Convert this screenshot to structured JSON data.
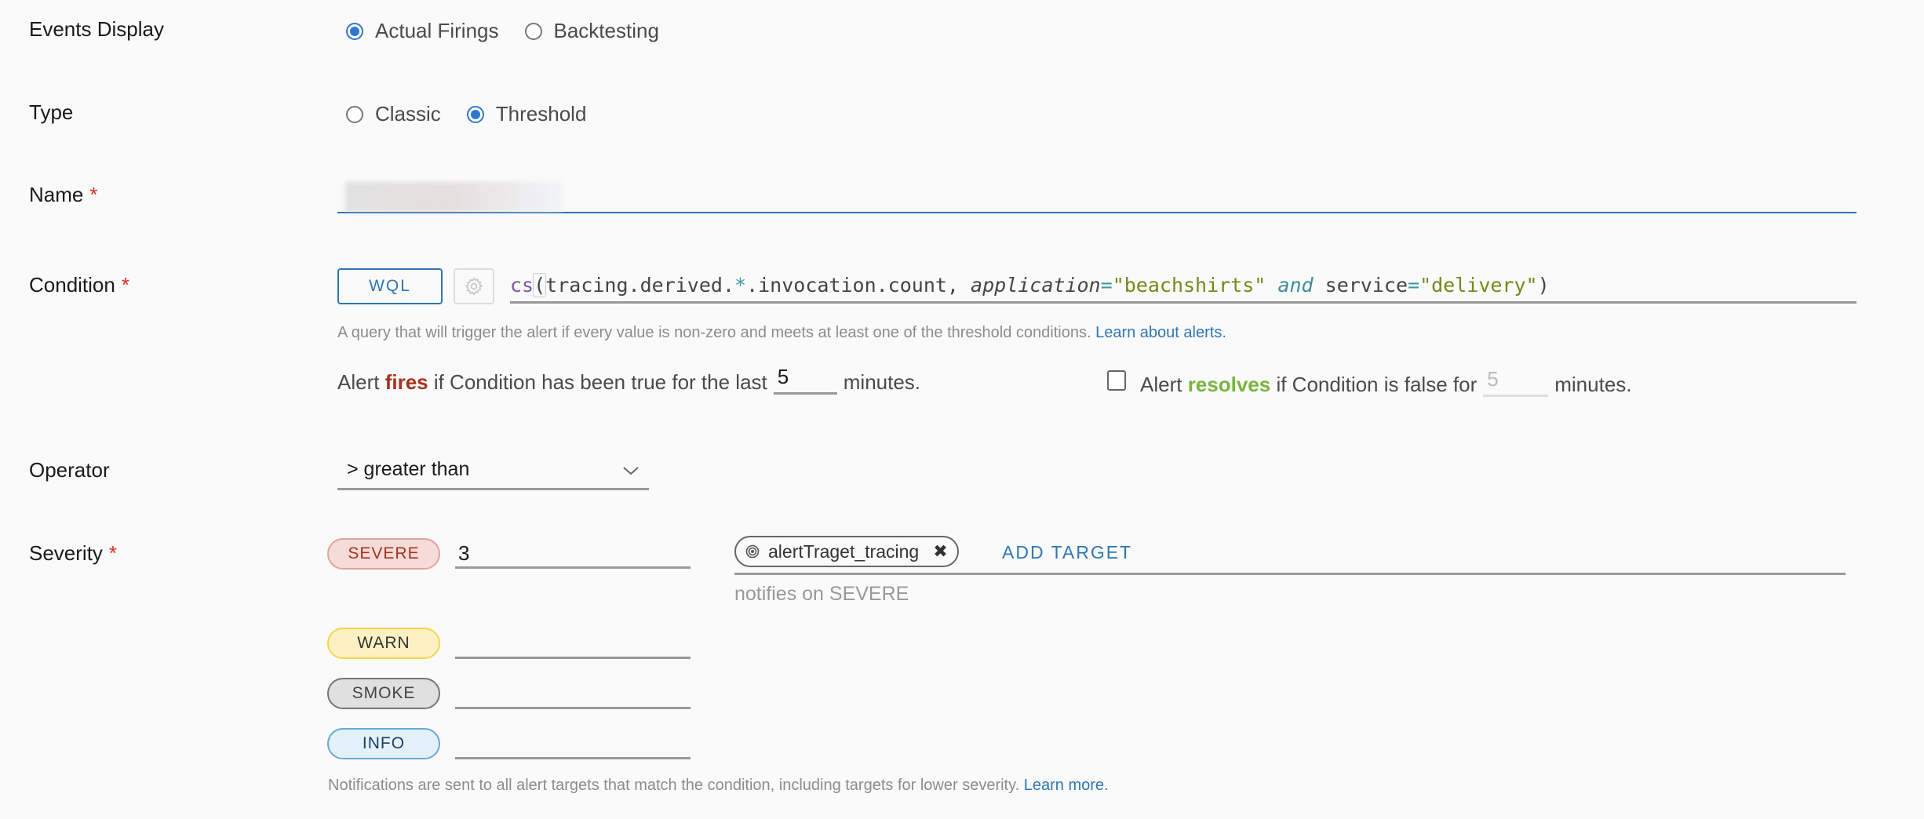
{
  "events_display": {
    "label": "Events Display",
    "options": [
      {
        "label": "Actual Firings",
        "selected": true
      },
      {
        "label": "Backtesting",
        "selected": false
      }
    ]
  },
  "type": {
    "label": "Type",
    "options": [
      {
        "label": "Classic",
        "selected": false
      },
      {
        "label": "Threshold",
        "selected": true
      }
    ]
  },
  "name": {
    "label": "Name",
    "required_mark": "*",
    "value": "",
    "value_obscured": true
  },
  "condition": {
    "label": "Condition",
    "required_mark": "*",
    "mode_button": "WQL",
    "settings_icon": "gear-icon",
    "query": {
      "full": "cs(tracing.derived.*.invocation.count, application=\"beachshirts\" and service=\"delivery\")",
      "fn": "cs",
      "open_paren": "(",
      "metric_a": "tracing.derived.",
      "wildcard": "*",
      "metric_b": ".invocation.count, ",
      "key1": "application",
      "eq1": "=",
      "val1": "\"beachshirts\"",
      "and_kw": "and",
      "key2": "service",
      "eq2": "=",
      "val2": "\"delivery\"",
      "close_paren": ")"
    },
    "hint_text": "A query that will trigger the alert if every value is non-zero and meets at least one of the threshold conditions. ",
    "hint_link": "Learn about alerts.",
    "fires": {
      "prefix": "Alert ",
      "keyword": "fires",
      "middle": " if Condition has been true for the last",
      "value": "5",
      "suffix": "minutes."
    },
    "resolves": {
      "checked": false,
      "prefix": "Alert ",
      "keyword": "resolves",
      "middle": " if Condition is false for",
      "placeholder": "5",
      "suffix": "minutes."
    }
  },
  "operator": {
    "label": "Operator",
    "selected": "> greater than"
  },
  "severity": {
    "label": "Severity",
    "required_mark": "*",
    "levels": [
      {
        "name": "SEVERE",
        "value": "3",
        "color": "#a8321d",
        "bg": "#f5dcd9",
        "border": "#e3a49c"
      },
      {
        "name": "WARN",
        "value": "",
        "color": "#333333",
        "bg": "#fdf1c4",
        "border": "#f5d64b"
      },
      {
        "name": "SMOKE",
        "value": "",
        "color": "#444444",
        "bg": "#e0e0e0",
        "border": "#777777"
      },
      {
        "name": "INFO",
        "value": "",
        "color": "#1d3f63",
        "bg": "#e3f1fa",
        "border": "#6aaad6"
      }
    ],
    "targets": [
      {
        "label": "alertTraget_tracing",
        "icon": "target-icon"
      }
    ],
    "add_target_label": "ADD TARGET",
    "notifies_text": "notifies on SEVERE",
    "footer_text": "Notifications are sent to all alert targets that match the condition, including targets for lower severity. ",
    "footer_link": "Learn more."
  }
}
